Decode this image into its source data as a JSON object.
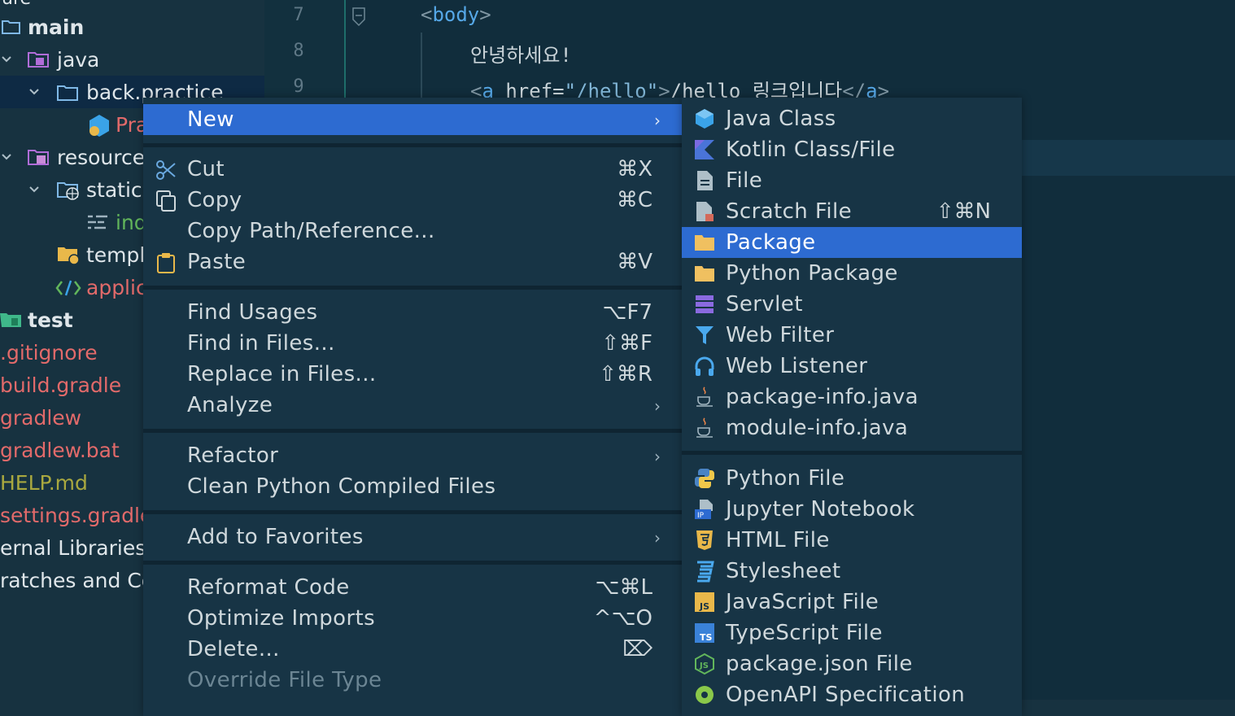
{
  "tree": {
    "top_fragment": "ure",
    "items": [
      {
        "label": "main"
      },
      {
        "label": "java"
      },
      {
        "label": "back.practice"
      },
      {
        "label": "Pra"
      },
      {
        "label": "resource"
      },
      {
        "label": "static"
      },
      {
        "label": "ind"
      },
      {
        "label": "templ"
      },
      {
        "label": "applic"
      },
      {
        "label": "test"
      },
      {
        "label": ".gitignore"
      },
      {
        "label": "build.gradle"
      },
      {
        "label": "gradlew"
      },
      {
        "label": "gradlew.bat"
      },
      {
        "label": "HELP.md"
      },
      {
        "label": "settings.gradle"
      },
      {
        "label": "ernal Libraries"
      },
      {
        "label": "ratches and Co"
      }
    ]
  },
  "editor": {
    "line_numbers": [
      "7",
      "8",
      "9"
    ],
    "lines": {
      "l7": {
        "open": "<",
        "tag": "body",
        "close": ">"
      },
      "l8": {
        "text": "안녕하세요!"
      },
      "l9": {
        "lt": "<",
        "tag": "a",
        "attr": " href=",
        "val": "\"/hello\"",
        "gt": ">",
        "text": "/hello 링크입니다",
        "end_lt": "</",
        "end_tag": "a",
        "end_gt": ">"
      }
    }
  },
  "menu": {
    "items": [
      {
        "label": "New",
        "shortcut": "",
        "submenu": true,
        "highlighted": true
      },
      {
        "label": "Cut",
        "shortcut": "⌘X",
        "icon": "scissors-icon"
      },
      {
        "label": "Copy",
        "shortcut": "⌘C",
        "icon": "copy-icon"
      },
      {
        "label": "Copy Path/Reference...",
        "shortcut": ""
      },
      {
        "label": "Paste",
        "shortcut": "⌘V",
        "icon": "clipboard-icon"
      },
      {
        "label": "Find Usages",
        "shortcut": "⌥F7"
      },
      {
        "label": "Find in Files...",
        "shortcut": "⇧⌘F"
      },
      {
        "label": "Replace in Files...",
        "shortcut": "⇧⌘R"
      },
      {
        "label": "Analyze",
        "shortcut": "",
        "submenu": true
      },
      {
        "label": "Refactor",
        "shortcut": "",
        "submenu": true
      },
      {
        "label": "Clean Python Compiled Files",
        "shortcut": ""
      },
      {
        "label": "Add to Favorites",
        "shortcut": "",
        "submenu": true
      },
      {
        "label": "Reformat Code",
        "shortcut": "⌥⌘L"
      },
      {
        "label": "Optimize Imports",
        "shortcut": "^⌥O"
      },
      {
        "label": "Delete...",
        "shortcut": "⌦"
      },
      {
        "label": "Override File Type",
        "shortcut": "",
        "disabled": true
      }
    ]
  },
  "submenu": {
    "items": [
      {
        "label": "Java Class",
        "icon": "java-class-icon"
      },
      {
        "label": "Kotlin Class/File",
        "icon": "kotlin-icon"
      },
      {
        "label": "File",
        "icon": "file-icon"
      },
      {
        "label": "Scratch File",
        "shortcut": "⇧⌘N",
        "icon": "scratch-file-icon"
      },
      {
        "label": "Package",
        "icon": "package-folder-icon",
        "highlighted": true
      },
      {
        "label": "Python Package",
        "icon": "python-package-icon"
      },
      {
        "label": "Servlet",
        "icon": "servlet-icon"
      },
      {
        "label": "Web Filter",
        "icon": "filter-icon"
      },
      {
        "label": "Web Listener",
        "icon": "headphones-icon"
      },
      {
        "label": "package-info.java",
        "icon": "java-cup-icon"
      },
      {
        "label": "module-info.java",
        "icon": "java-cup-icon"
      },
      {
        "label": "Python File",
        "icon": "python-icon"
      },
      {
        "label": "Jupyter Notebook",
        "icon": "jupyter-icon"
      },
      {
        "label": "HTML File",
        "icon": "html5-icon"
      },
      {
        "label": "Stylesheet",
        "icon": "css3-icon"
      },
      {
        "label": "JavaScript File",
        "icon": "javascript-icon"
      },
      {
        "label": "TypeScript File",
        "icon": "typescript-icon"
      },
      {
        "label": "package.json File",
        "icon": "nodejs-icon"
      },
      {
        "label": "OpenAPI Specification",
        "icon": "openapi-icon"
      }
    ]
  },
  "colors": {
    "highlight": "#2d6bd1",
    "menu_bg": "#173445",
    "tree_bg": "#173240",
    "editor_bg": "#112d3c"
  }
}
